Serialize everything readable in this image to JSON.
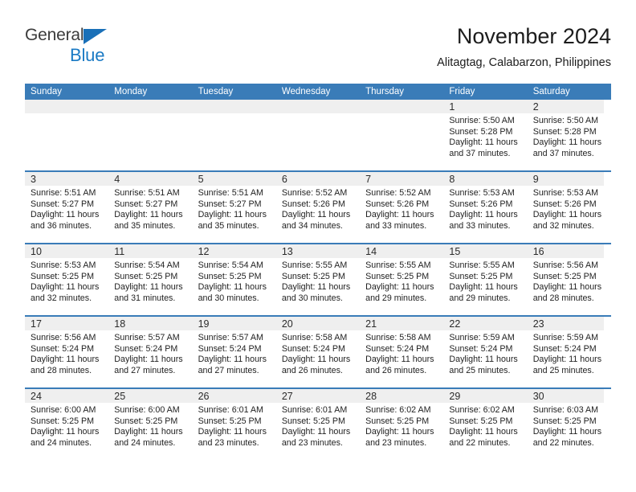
{
  "brand": {
    "name_part1": "General",
    "name_part2": "Blue",
    "triangle_icon": "triangle-icon",
    "accent_color": "#1a7ac4"
  },
  "header": {
    "title": "November 2024",
    "subtitle": "Alitagtag, Calabarzon, Philippines"
  },
  "theme": {
    "header_bar_color": "#3a7cb8",
    "date_band_color": "#efefef",
    "text_color": "#1f1f1f"
  },
  "weekdays": [
    "Sunday",
    "Monday",
    "Tuesday",
    "Wednesday",
    "Thursday",
    "Friday",
    "Saturday"
  ],
  "weeks": [
    [
      {
        "day": ""
      },
      {
        "day": ""
      },
      {
        "day": ""
      },
      {
        "day": ""
      },
      {
        "day": ""
      },
      {
        "day": "1",
        "sunrise": "Sunrise: 5:50 AM",
        "sunset": "Sunset: 5:28 PM",
        "daylight1": "Daylight: 11 hours",
        "daylight2": "and 37 minutes."
      },
      {
        "day": "2",
        "sunrise": "Sunrise: 5:50 AM",
        "sunset": "Sunset: 5:28 PM",
        "daylight1": "Daylight: 11 hours",
        "daylight2": "and 37 minutes."
      }
    ],
    [
      {
        "day": "3",
        "sunrise": "Sunrise: 5:51 AM",
        "sunset": "Sunset: 5:27 PM",
        "daylight1": "Daylight: 11 hours",
        "daylight2": "and 36 minutes."
      },
      {
        "day": "4",
        "sunrise": "Sunrise: 5:51 AM",
        "sunset": "Sunset: 5:27 PM",
        "daylight1": "Daylight: 11 hours",
        "daylight2": "and 35 minutes."
      },
      {
        "day": "5",
        "sunrise": "Sunrise: 5:51 AM",
        "sunset": "Sunset: 5:27 PM",
        "daylight1": "Daylight: 11 hours",
        "daylight2": "and 35 minutes."
      },
      {
        "day": "6",
        "sunrise": "Sunrise: 5:52 AM",
        "sunset": "Sunset: 5:26 PM",
        "daylight1": "Daylight: 11 hours",
        "daylight2": "and 34 minutes."
      },
      {
        "day": "7",
        "sunrise": "Sunrise: 5:52 AM",
        "sunset": "Sunset: 5:26 PM",
        "daylight1": "Daylight: 11 hours",
        "daylight2": "and 33 minutes."
      },
      {
        "day": "8",
        "sunrise": "Sunrise: 5:53 AM",
        "sunset": "Sunset: 5:26 PM",
        "daylight1": "Daylight: 11 hours",
        "daylight2": "and 33 minutes."
      },
      {
        "day": "9",
        "sunrise": "Sunrise: 5:53 AM",
        "sunset": "Sunset: 5:26 PM",
        "daylight1": "Daylight: 11 hours",
        "daylight2": "and 32 minutes."
      }
    ],
    [
      {
        "day": "10",
        "sunrise": "Sunrise: 5:53 AM",
        "sunset": "Sunset: 5:25 PM",
        "daylight1": "Daylight: 11 hours",
        "daylight2": "and 32 minutes."
      },
      {
        "day": "11",
        "sunrise": "Sunrise: 5:54 AM",
        "sunset": "Sunset: 5:25 PM",
        "daylight1": "Daylight: 11 hours",
        "daylight2": "and 31 minutes."
      },
      {
        "day": "12",
        "sunrise": "Sunrise: 5:54 AM",
        "sunset": "Sunset: 5:25 PM",
        "daylight1": "Daylight: 11 hours",
        "daylight2": "and 30 minutes."
      },
      {
        "day": "13",
        "sunrise": "Sunrise: 5:55 AM",
        "sunset": "Sunset: 5:25 PM",
        "daylight1": "Daylight: 11 hours",
        "daylight2": "and 30 minutes."
      },
      {
        "day": "14",
        "sunrise": "Sunrise: 5:55 AM",
        "sunset": "Sunset: 5:25 PM",
        "daylight1": "Daylight: 11 hours",
        "daylight2": "and 29 minutes."
      },
      {
        "day": "15",
        "sunrise": "Sunrise: 5:55 AM",
        "sunset": "Sunset: 5:25 PM",
        "daylight1": "Daylight: 11 hours",
        "daylight2": "and 29 minutes."
      },
      {
        "day": "16",
        "sunrise": "Sunrise: 5:56 AM",
        "sunset": "Sunset: 5:25 PM",
        "daylight1": "Daylight: 11 hours",
        "daylight2": "and 28 minutes."
      }
    ],
    [
      {
        "day": "17",
        "sunrise": "Sunrise: 5:56 AM",
        "sunset": "Sunset: 5:24 PM",
        "daylight1": "Daylight: 11 hours",
        "daylight2": "and 28 minutes."
      },
      {
        "day": "18",
        "sunrise": "Sunrise: 5:57 AM",
        "sunset": "Sunset: 5:24 PM",
        "daylight1": "Daylight: 11 hours",
        "daylight2": "and 27 minutes."
      },
      {
        "day": "19",
        "sunrise": "Sunrise: 5:57 AM",
        "sunset": "Sunset: 5:24 PM",
        "daylight1": "Daylight: 11 hours",
        "daylight2": "and 27 minutes."
      },
      {
        "day": "20",
        "sunrise": "Sunrise: 5:58 AM",
        "sunset": "Sunset: 5:24 PM",
        "daylight1": "Daylight: 11 hours",
        "daylight2": "and 26 minutes."
      },
      {
        "day": "21",
        "sunrise": "Sunrise: 5:58 AM",
        "sunset": "Sunset: 5:24 PM",
        "daylight1": "Daylight: 11 hours",
        "daylight2": "and 26 minutes."
      },
      {
        "day": "22",
        "sunrise": "Sunrise: 5:59 AM",
        "sunset": "Sunset: 5:24 PM",
        "daylight1": "Daylight: 11 hours",
        "daylight2": "and 25 minutes."
      },
      {
        "day": "23",
        "sunrise": "Sunrise: 5:59 AM",
        "sunset": "Sunset: 5:24 PM",
        "daylight1": "Daylight: 11 hours",
        "daylight2": "and 25 minutes."
      }
    ],
    [
      {
        "day": "24",
        "sunrise": "Sunrise: 6:00 AM",
        "sunset": "Sunset: 5:25 PM",
        "daylight1": "Daylight: 11 hours",
        "daylight2": "and 24 minutes."
      },
      {
        "day": "25",
        "sunrise": "Sunrise: 6:00 AM",
        "sunset": "Sunset: 5:25 PM",
        "daylight1": "Daylight: 11 hours",
        "daylight2": "and 24 minutes."
      },
      {
        "day": "26",
        "sunrise": "Sunrise: 6:01 AM",
        "sunset": "Sunset: 5:25 PM",
        "daylight1": "Daylight: 11 hours",
        "daylight2": "and 23 minutes."
      },
      {
        "day": "27",
        "sunrise": "Sunrise: 6:01 AM",
        "sunset": "Sunset: 5:25 PM",
        "daylight1": "Daylight: 11 hours",
        "daylight2": "and 23 minutes."
      },
      {
        "day": "28",
        "sunrise": "Sunrise: 6:02 AM",
        "sunset": "Sunset: 5:25 PM",
        "daylight1": "Daylight: 11 hours",
        "daylight2": "and 23 minutes."
      },
      {
        "day": "29",
        "sunrise": "Sunrise: 6:02 AM",
        "sunset": "Sunset: 5:25 PM",
        "daylight1": "Daylight: 11 hours",
        "daylight2": "and 22 minutes."
      },
      {
        "day": "30",
        "sunrise": "Sunrise: 6:03 AM",
        "sunset": "Sunset: 5:25 PM",
        "daylight1": "Daylight: 11 hours",
        "daylight2": "and 22 minutes."
      }
    ]
  ]
}
